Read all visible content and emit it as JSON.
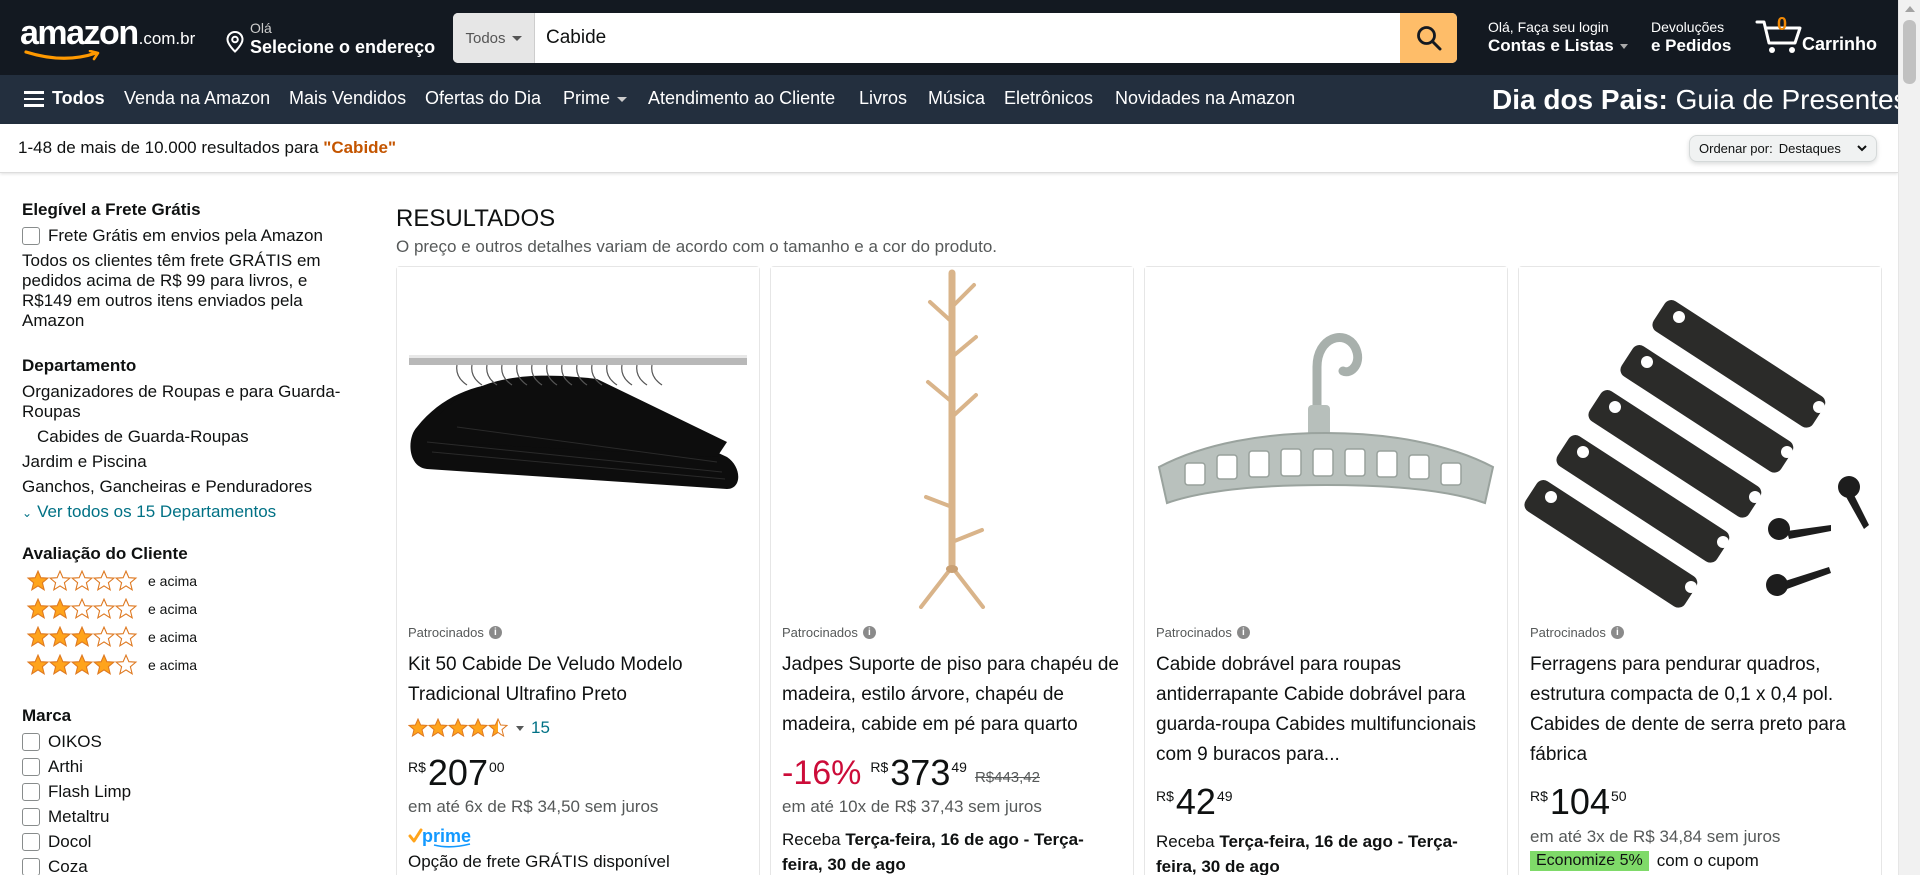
{
  "header": {
    "logo_text": "amazon",
    "logo_tld": ".com.br",
    "address_line1": "Olá",
    "address_line2": "Selecione o endereço",
    "search_category": "Todos",
    "search_value": "Cabide",
    "account_line1": "Olá, Faça seu login",
    "account_line2": "Contas e Listas",
    "returns_line1": "Devoluções",
    "returns_line2": "e Pedidos",
    "cart_count": "0",
    "cart_label": "Carrinho",
    "accent_color": "#febd69"
  },
  "subnav": {
    "all_label": "Todos",
    "items": [
      "Venda na Amazon",
      "Mais Vendidos",
      "Ofertas do Dia",
      "Prime",
      "Atendimento ao Cliente",
      "Livros",
      "Música",
      "Eletrônicos",
      "Novidades na Amazon"
    ],
    "promo_bold": "Dia dos Pais:",
    "promo_rest": " Guia de Presentes"
  },
  "results_bar": {
    "count_text": "1-48 de mais de 10.000 resultados para ",
    "query": "\"Cabide\"",
    "sort_label": "Ordenar por:",
    "sort_value": "Destaques"
  },
  "sidebar": {
    "free_shipping": {
      "heading": "Elegível a Frete Grátis",
      "checkbox_label": "Frete Grátis em envios pela Amazon",
      "note": "Todos os clientes têm frete GRÁTIS em pedidos acima de R$ 99 para livros, e R$149 em outros itens enviados pela Amazon"
    },
    "department": {
      "heading": "Departamento",
      "items": [
        "Organizadores de Roupas e para Guarda-Roupas",
        "Cabides de Guarda-Roupas",
        "Jardim e Piscina",
        "Ganchos, Gancheiras e Penduradores"
      ],
      "see_all": "Ver todos os 15 Departamentos"
    },
    "rating": {
      "heading": "Avaliação do Cliente",
      "suffix": "e acima",
      "levels": [
        1,
        2,
        3,
        4
      ]
    },
    "brand": {
      "heading": "Marca",
      "items": [
        "OIKOS",
        "Arthi",
        "Flash Limp",
        "Metaltru",
        "Docol",
        "Coza"
      ]
    }
  },
  "main": {
    "heading": "RESULTADOS",
    "subheading": "O preço e outros detalhes variam de acordo com o tamanho e a cor do produto.",
    "sponsored_label": "Patrocinados",
    "products": [
      {
        "title": "Kit 50 Cabide De Veludo Modelo Tradicional Ultrafino Preto",
        "rating": 4.5,
        "rating_count": "15",
        "currency": "R$",
        "price_whole": "207",
        "price_cents": "00",
        "installments": "em até 6x de R$ 34,50 sem juros",
        "prime": "prime",
        "shipping": "Opção de frete GRÁTIS disponível"
      },
      {
        "title": "Jadpes Suporte de piso para chapéu de madeira, estilo árvore, chapéu de madeira, cabide em pé para quarto",
        "discount": "-16%",
        "currency": "R$",
        "price_whole": "373",
        "price_cents": "49",
        "old_price": "R$443,42",
        "installments": "em até 10x de R$ 37,43 sem juros",
        "delivery_prefix": "Receba ",
        "delivery_bold": "Terça-feira, 16 de ago - Terça-feira, 30 de ago"
      },
      {
        "title": "Cabide dobrável para roupas antiderrapante Cabide dobrável para guarda-roupa Cabides multifuncionais com 9 buracos para...",
        "currency": "R$",
        "price_whole": "42",
        "price_cents": "49",
        "delivery_prefix": "Receba ",
        "delivery_bold": "Terça-feira, 16 de ago - Terça-feira, 30 de ago"
      },
      {
        "title": "Ferragens para pendurar quadros, estrutura compacta de 0,1 x 0,4 pol. Cabides de dente de serra preto para fábrica",
        "currency": "R$",
        "price_whole": "104",
        "price_cents": "50",
        "installments": "em até 3x de R$ 34,84 sem juros",
        "coupon_badge": "Economize 5%",
        "coupon_text": "com o cupom"
      }
    ]
  }
}
